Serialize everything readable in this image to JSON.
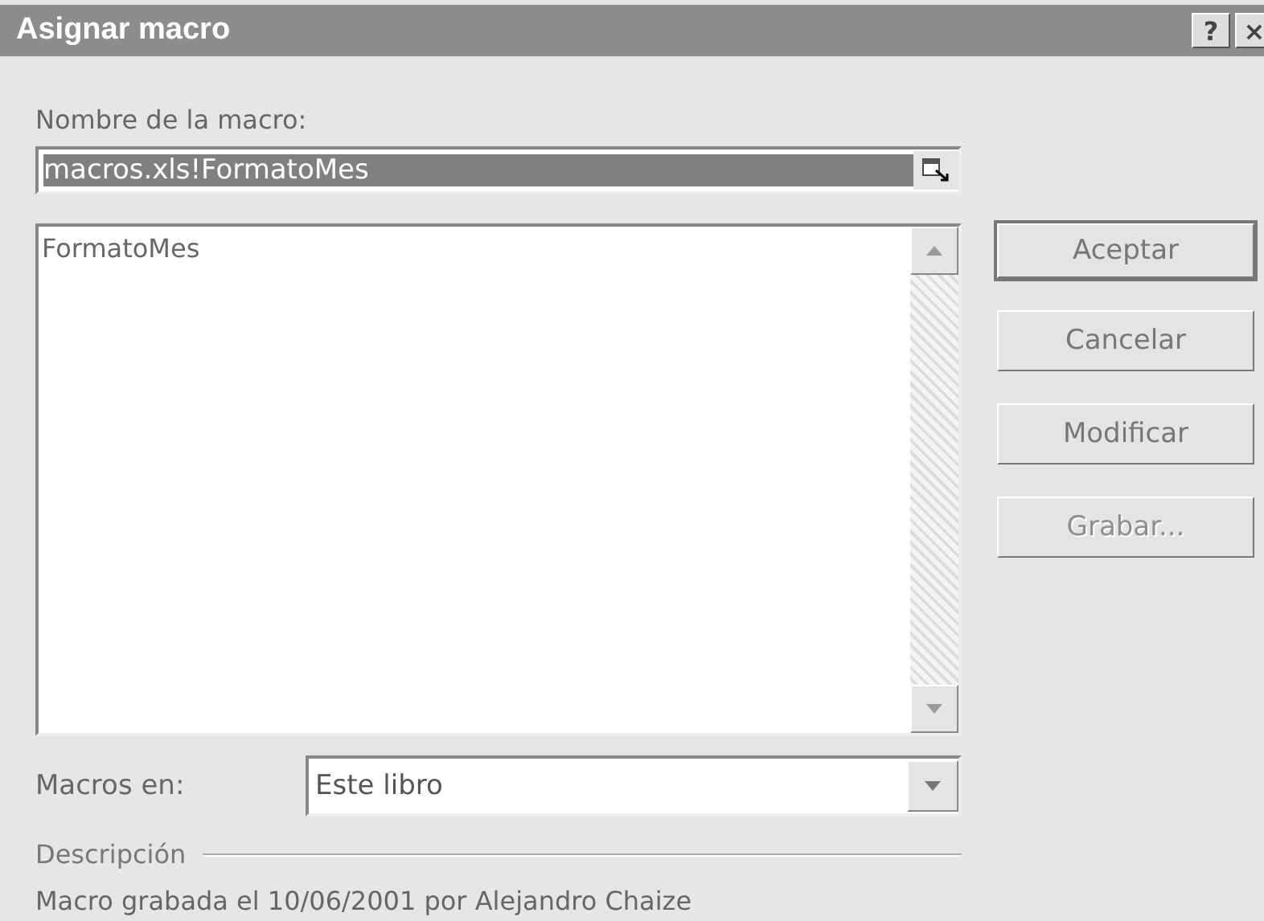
{
  "window": {
    "title": "Asignar macro",
    "title_buttons": [
      "?",
      "×"
    ]
  },
  "macro_name": {
    "label": "Nombre de la macro:",
    "value": "macros.xls!FormatoMes",
    "selected": true
  },
  "macro_list": {
    "items": [
      {
        "label": "FormatoMes",
        "selected": false
      }
    ]
  },
  "buttons": [
    {
      "label": "Aceptar",
      "default": true,
      "disabled": false
    },
    {
      "label": "Cancelar",
      "default": false,
      "disabled": false
    },
    {
      "label": "Modificar",
      "default": false,
      "disabled": false
    },
    {
      "label": "Grabar...",
      "default": false,
      "disabled": true
    }
  ],
  "macros_in": {
    "label": "Macros en:",
    "value": "Este libro"
  },
  "description": {
    "label": "Descripción",
    "text": "Macro grabada el 10/06/2001 por Alejandro Chaize"
  }
}
